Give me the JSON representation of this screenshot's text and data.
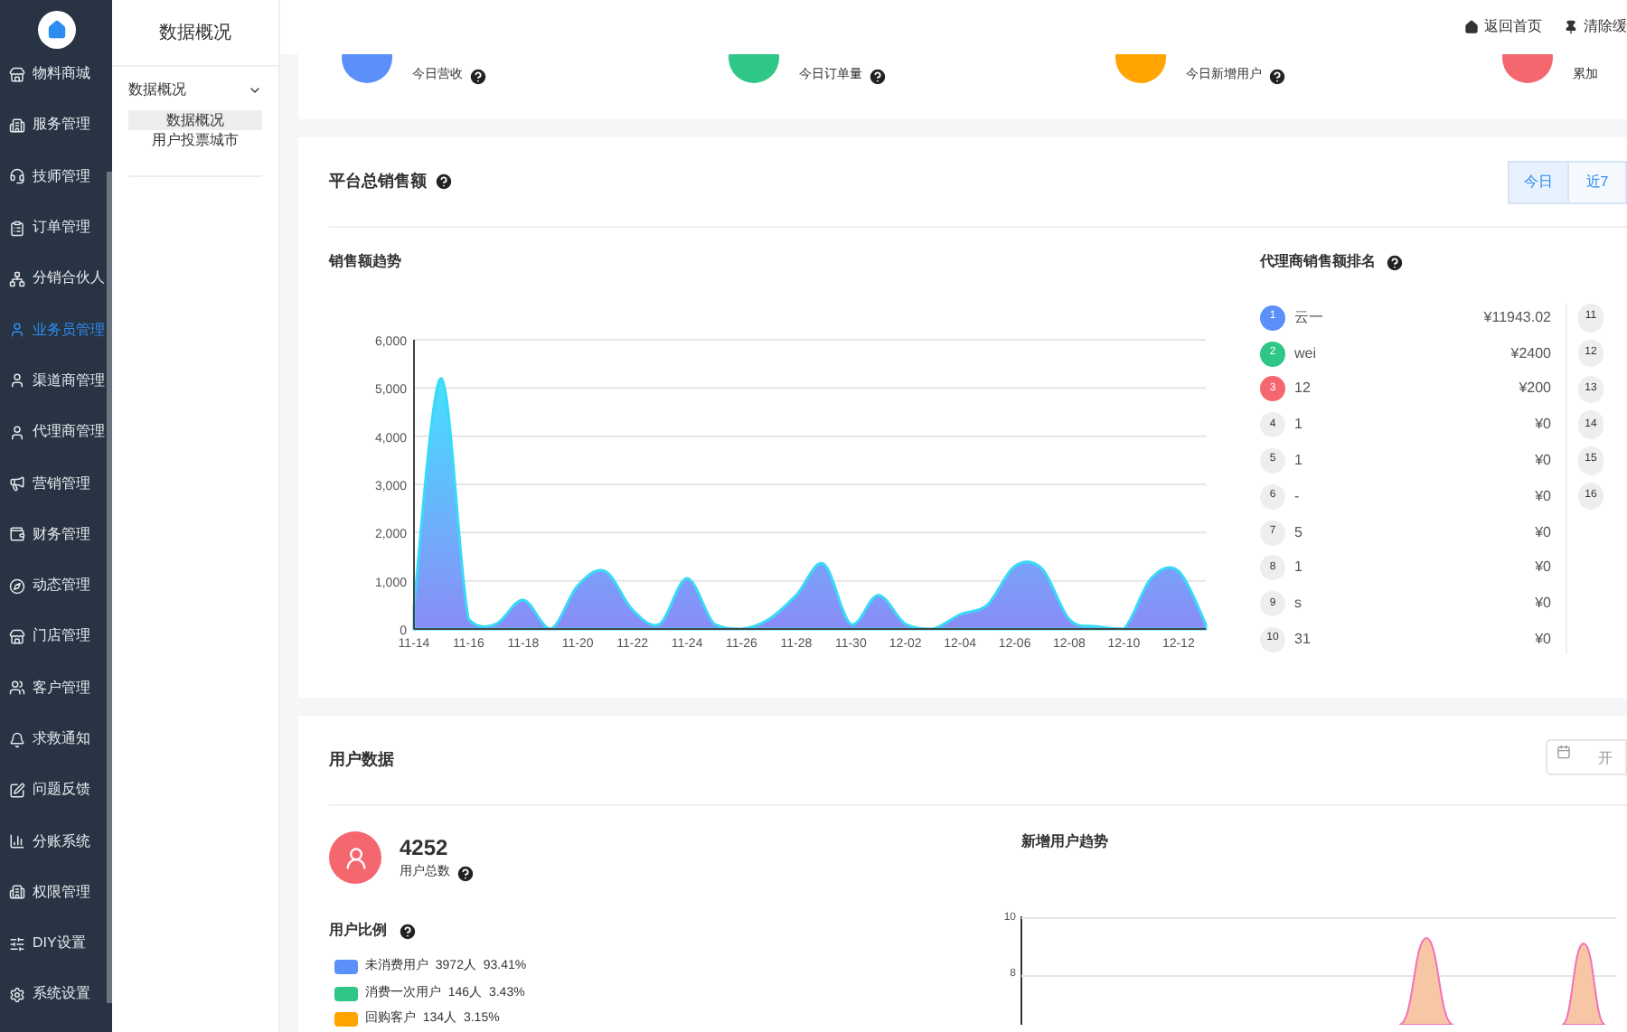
{
  "nav": {
    "items": [
      {
        "label": "物料商城",
        "selected": false
      },
      {
        "label": "服务管理",
        "selected": false
      },
      {
        "label": "技师管理",
        "selected": false
      },
      {
        "label": "订单管理",
        "selected": false
      },
      {
        "label": "分销合伙人",
        "selected": false
      },
      {
        "label": "业务员管理",
        "selected": true
      },
      {
        "label": "渠道商管理",
        "selected": false
      },
      {
        "label": "代理商管理",
        "selected": false
      },
      {
        "label": "营销管理",
        "selected": false
      },
      {
        "label": "财务管理",
        "selected": false
      },
      {
        "label": "动态管理",
        "selected": false
      },
      {
        "label": "门店管理",
        "selected": false
      },
      {
        "label": "客户管理",
        "selected": false
      },
      {
        "label": "求救通知",
        "selected": false
      },
      {
        "label": "问题反馈",
        "selected": false
      },
      {
        "label": "分账系统",
        "selected": false
      },
      {
        "label": "权限管理",
        "selected": false
      },
      {
        "label": "DIY设置",
        "selected": false
      },
      {
        "label": "系统设置",
        "selected": false
      }
    ]
  },
  "subnav": {
    "title": "数据概况",
    "group": {
      "label": "数据概况",
      "expanded": true,
      "items": [
        {
          "label": "数据概况",
          "selected": true
        },
        {
          "label": "用户投票城市",
          "selected": false
        }
      ]
    }
  },
  "header": {
    "links": [
      {
        "label": "返回首页"
      },
      {
        "label": "清除缓"
      }
    ]
  },
  "stats": [
    {
      "label": "今日营收",
      "color": "#5b8ff9"
    },
    {
      "label": "今日订单量",
      "color": "#2fc787"
    },
    {
      "label": "今日新增用户",
      "color": "#ffa400"
    },
    {
      "label": "累加",
      "color": "#f5676f"
    }
  ],
  "sales": {
    "title": "平台总销售额",
    "tabs": [
      {
        "label": "今日",
        "selected": true
      },
      {
        "label": "近7",
        "selected": false
      }
    ],
    "trend": {
      "title": "销售额趋势",
      "chart_data": {
        "type": "area",
        "grid": true,
        "categories": [
          "11-14",
          null,
          "11-16",
          null,
          "11-18",
          null,
          "11-20",
          null,
          "11-22",
          null,
          "11-24",
          null,
          "11-26",
          null,
          "11-28",
          null,
          "11-30",
          null,
          "12-02",
          null,
          "12-04",
          null,
          "12-06",
          null,
          "12-08",
          null,
          "12-10",
          null,
          "12-12",
          null
        ],
        "series": [
          {
            "color": "#39d9f7",
            "values": [
              500,
              5200,
              200,
              100,
              600,
              0,
              900,
              1200,
              400,
              100,
              1050,
              100,
              0,
              200,
              700,
              1350,
              100,
              700,
              100,
              0,
              300,
              500,
              1300,
              1250,
              200,
              50,
              0,
              1050,
              1200,
              100
            ]
          }
        ],
        "ylim": [
          0,
          6000
        ],
        "yticks": [
          {
            "value": 0,
            "label": "0"
          },
          {
            "value": 1000,
            "label": "1,000"
          },
          {
            "value": 2000,
            "label": "2,000"
          },
          {
            "value": 3000,
            "label": "3,000"
          },
          {
            "value": 4000,
            "label": "4,000"
          },
          {
            "value": 5000,
            "label": "5,000"
          },
          {
            "value": 6000,
            "label": "6,000"
          }
        ]
      }
    },
    "ranking": {
      "title": "代理商销售额排名",
      "rows": [
        {
          "rank": "1",
          "name": "云一",
          "amount": "¥11943.02",
          "color": "#5b8ff9"
        },
        {
          "rank": "2",
          "name": "wei",
          "amount": "¥2400",
          "color": "#2fc787"
        },
        {
          "rank": "3",
          "name": "12",
          "amount": "¥200",
          "color": "#f5676f"
        },
        {
          "rank": "4",
          "name": "1",
          "amount": "¥0",
          "color": "#eeeeee"
        },
        {
          "rank": "5",
          "name": "1",
          "amount": "¥0",
          "color": "#eeeeee"
        },
        {
          "rank": "6",
          "name": "-",
          "amount": "¥0",
          "color": "#eeeeee"
        },
        {
          "rank": "7",
          "name": "5",
          "amount": "¥0",
          "color": "#eeeeee"
        },
        {
          "rank": "8",
          "name": "1",
          "amount": "¥0",
          "color": "#eeeeee"
        },
        {
          "rank": "9",
          "name": "s",
          "amount": "¥0",
          "color": "#eeeeee"
        },
        {
          "rank": "10",
          "name": "31",
          "amount": "¥0",
          "color": "#eeeeee"
        }
      ],
      "more_ranks": [
        "11",
        "12",
        "13",
        "14",
        "15",
        "16"
      ]
    }
  },
  "users": {
    "title": "用户数据",
    "date_field": {
      "placeholder": "开"
    },
    "total": "4252",
    "total_label": "用户总数",
    "ratio_title": "用户比例",
    "legend": [
      {
        "label": "未消费用户  3972人  93.41%",
        "color": "#5b8ff9"
      },
      {
        "label": "消费一次用户  146人  3.43%",
        "color": "#2fc787"
      },
      {
        "label": "回购客户  134人  3.15%",
        "color": "#ffa400"
      }
    ],
    "trend_title": "新增用户趋势",
    "trend_axis": [
      "10",
      "8"
    ]
  }
}
